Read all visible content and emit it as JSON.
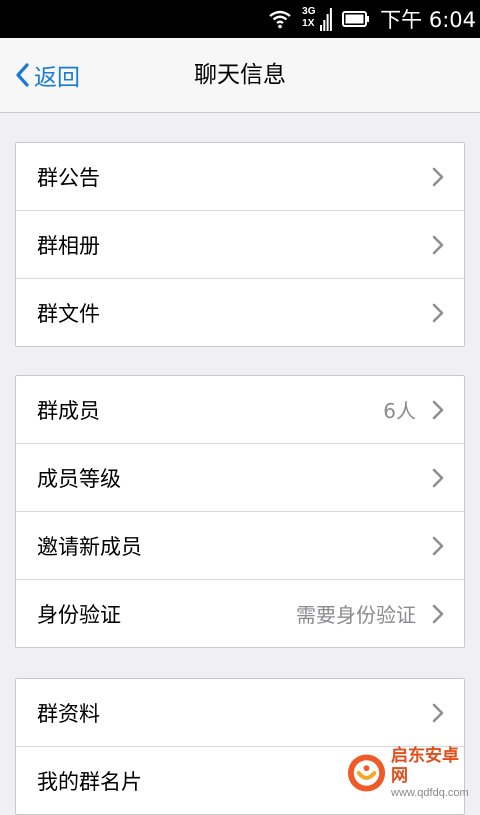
{
  "status_bar": {
    "network_top": "3G",
    "network_bottom": "1X",
    "time": "下午 6:04",
    "icons": [
      "wifi-icon",
      "signal-icon",
      "battery-icon"
    ]
  },
  "nav": {
    "back_label": "返回",
    "title": "聊天信息",
    "accent_color": "#1a7bd6"
  },
  "groups": [
    {
      "rows": [
        {
          "label": "群公告",
          "value": ""
        },
        {
          "label": "群相册",
          "value": ""
        },
        {
          "label": "群文件",
          "value": ""
        }
      ]
    },
    {
      "rows": [
        {
          "label": "群成员",
          "value": "6人"
        },
        {
          "label": "成员等级",
          "value": ""
        },
        {
          "label": "邀请新成员",
          "value": ""
        },
        {
          "label": "身份验证",
          "value": "需要身份验证"
        }
      ]
    },
    {
      "rows": [
        {
          "label": "群资料",
          "value": ""
        },
        {
          "label": "我的群名片",
          "value": ""
        }
      ]
    }
  ],
  "watermark": {
    "title": "启东安卓网",
    "url": "www.qdfdq.com"
  }
}
